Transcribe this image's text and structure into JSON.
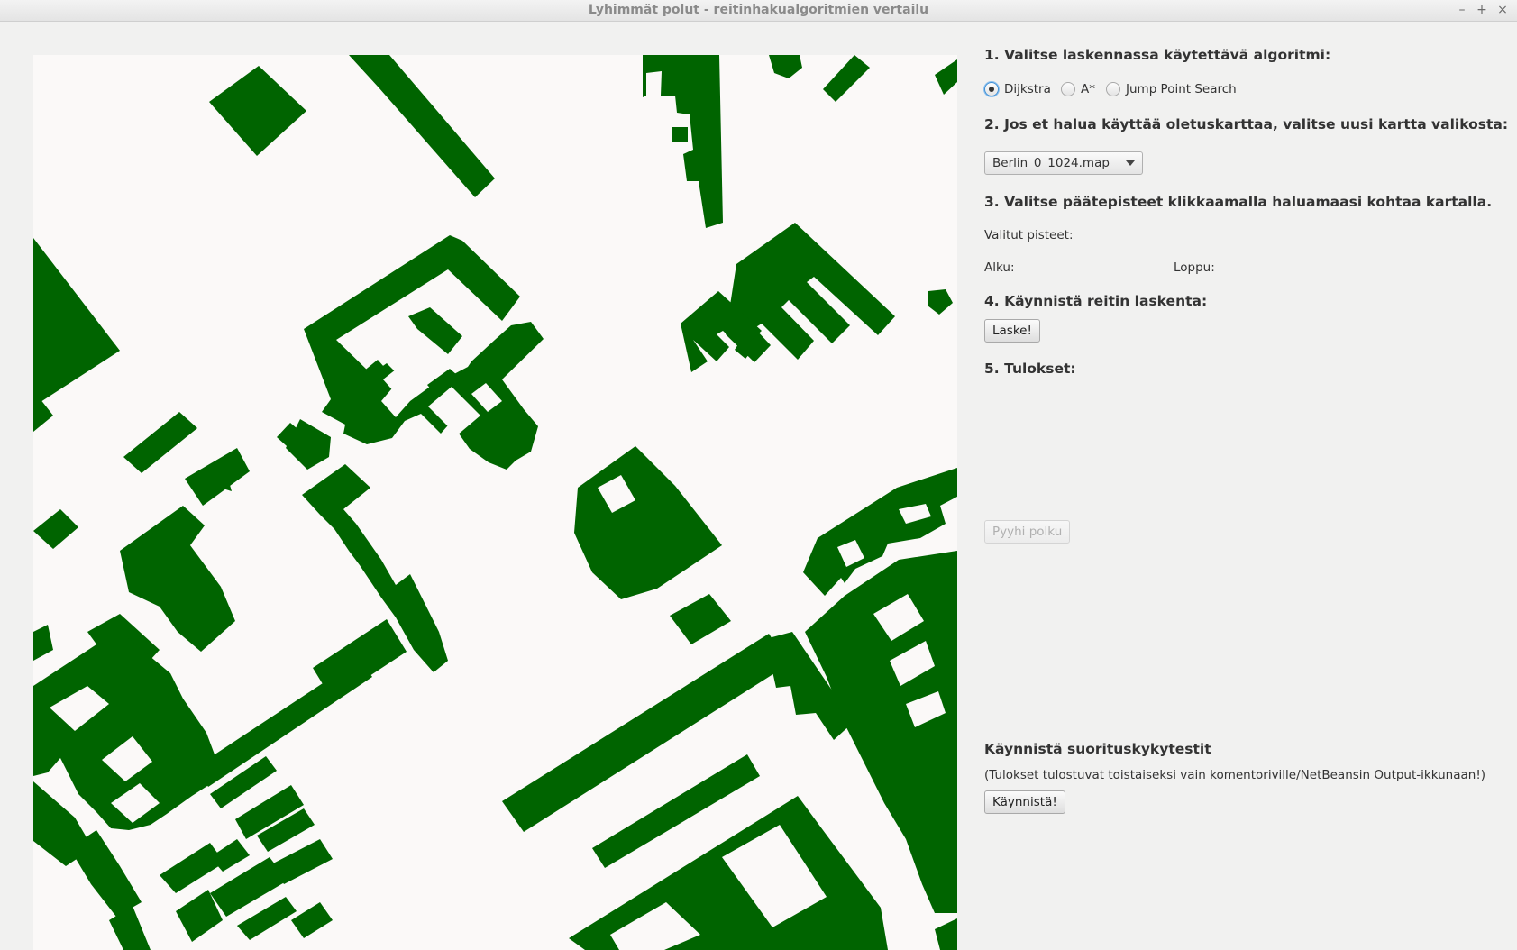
{
  "window": {
    "title": "Lyhimmät polut - reitinhakualgoritmien vertailu",
    "controls": {
      "minimize": "–",
      "maximize": "+",
      "close": "×"
    }
  },
  "map": {
    "wall_color": "#006400",
    "free_color": "#fbf9f8"
  },
  "panel": {
    "step1": "1. Valitse laskennassa käytettävä algoritmi:",
    "algorithms": [
      {
        "label": "Dijkstra",
        "selected": true
      },
      {
        "label": "A*",
        "selected": false
      },
      {
        "label": "Jump Point Search",
        "selected": false
      }
    ],
    "step2": "2. Jos et halua käyttää oletuskarttaa, valitse uusi kartta valikosta:",
    "map_select_value": "Berlin_0_1024.map",
    "step3": "3. Valitse päätepisteet klikkaamalla haluamaasi kohtaa kartalla.",
    "selected_points_label": "Valitut pisteet:",
    "start_label": "Alku:",
    "end_label": "Loppu:",
    "step4": "4. Käynnistä reitin laskenta:",
    "calculate_button": "Laske!",
    "step5": "5. Tulokset:",
    "clear_path_button": "Pyyhi polku",
    "perf_heading": "Käynnistä suorituskykytestit",
    "perf_note": "(Tulokset tulostuvat toistaiseksi vain komentoriville/NetBeansin Output-ikkunaan!)",
    "perf_button": "Käynnistä!"
  }
}
